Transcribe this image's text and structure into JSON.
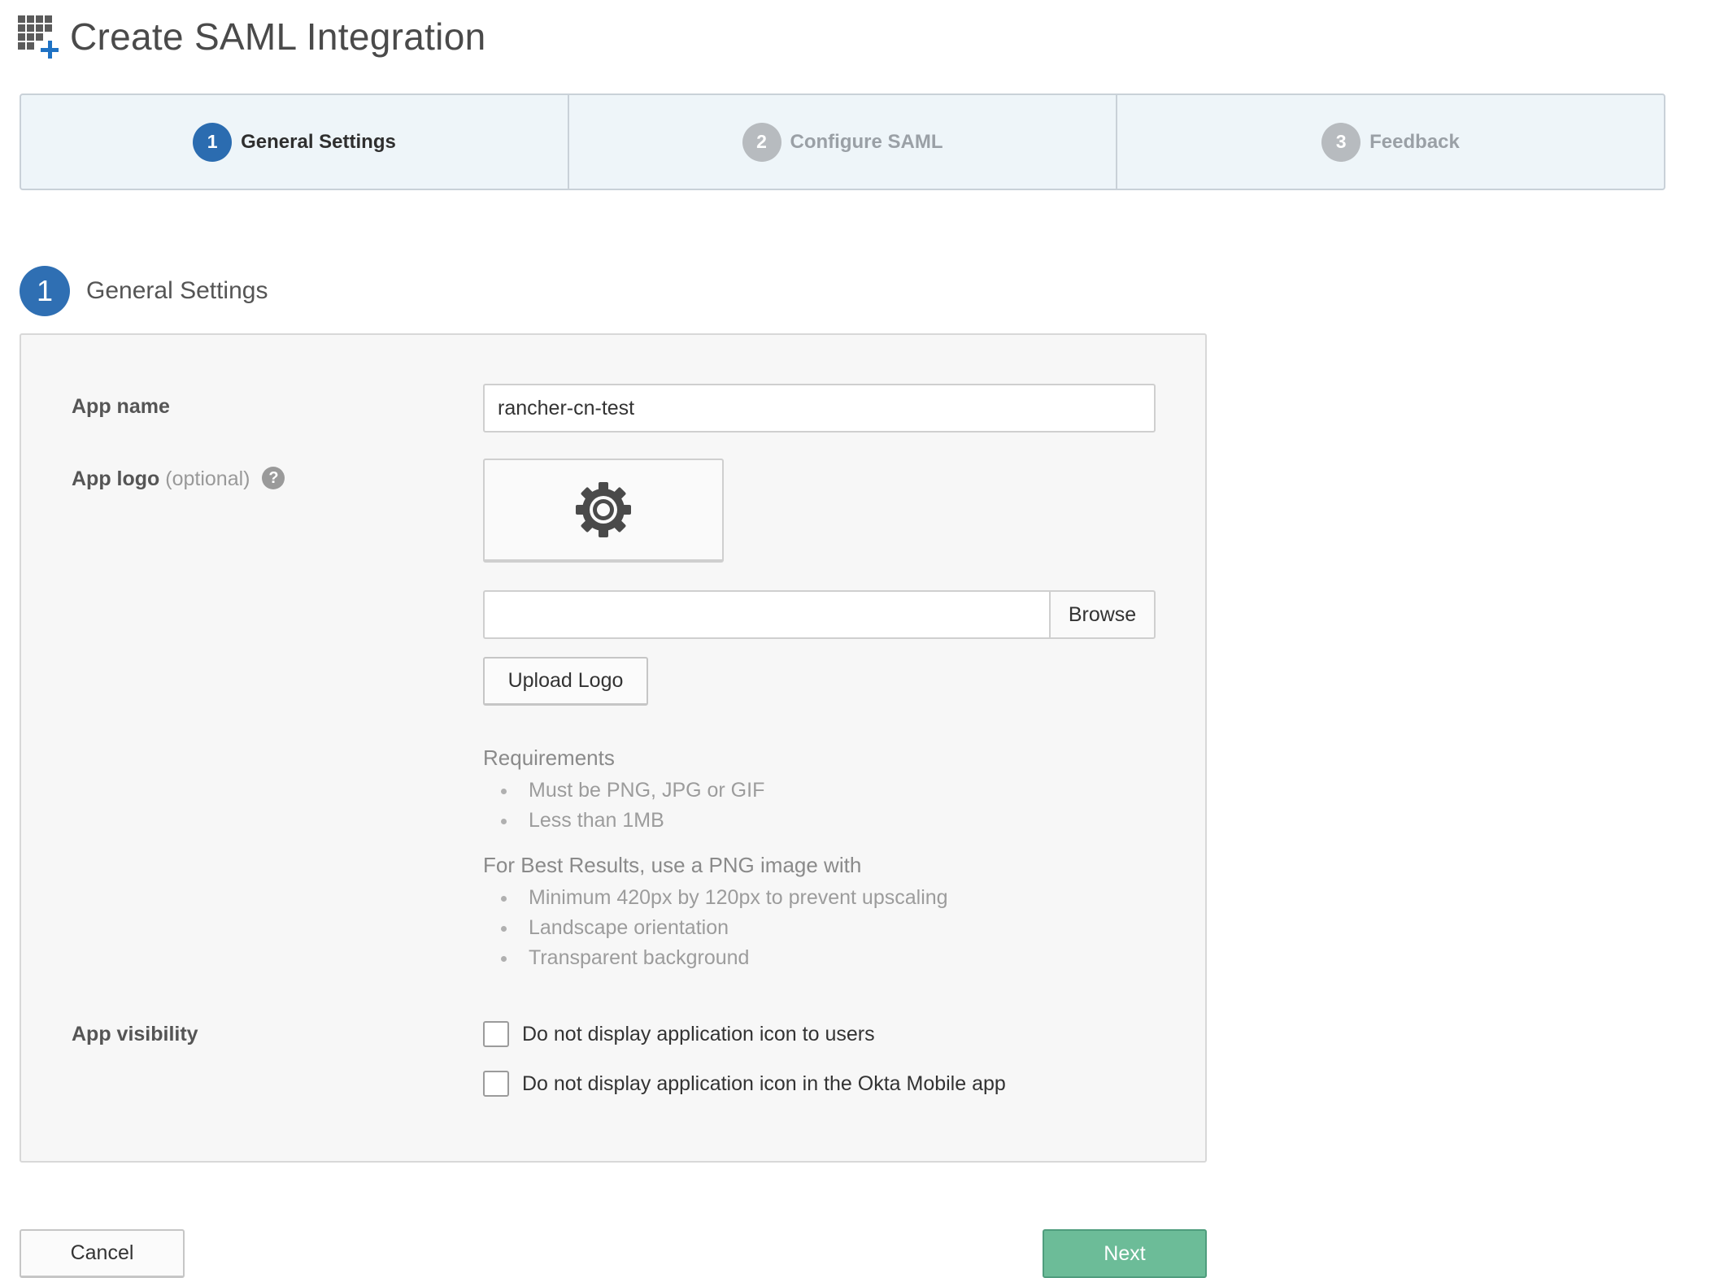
{
  "header": {
    "icon": "app-grid-add-icon",
    "title": "Create SAML Integration"
  },
  "wizard": {
    "steps": [
      {
        "number": "1",
        "label": "General Settings",
        "active": true
      },
      {
        "number": "2",
        "label": "Configure SAML",
        "active": false
      },
      {
        "number": "3",
        "label": "Feedback",
        "active": false
      }
    ]
  },
  "section": {
    "number": "1",
    "title": "General Settings"
  },
  "form": {
    "app_name": {
      "label": "App name",
      "value": "rancher-cn-test"
    },
    "app_logo": {
      "label": "App logo",
      "optional": "(optional)",
      "help": "?",
      "placeholder_icon": "gear-icon",
      "file_value": "",
      "browse_label": "Browse",
      "upload_label": "Upload Logo",
      "requirements_title": "Requirements",
      "requirements": [
        "Must be PNG, JPG or GIF",
        "Less than 1MB"
      ],
      "best_results_title": "For Best Results, use a PNG image with",
      "best_results": [
        "Minimum 420px by 120px to prevent upscaling",
        "Landscape orientation",
        "Transparent background"
      ]
    },
    "app_visibility": {
      "label": "App visibility",
      "options": [
        {
          "label": "Do not display application icon to users",
          "checked": false
        },
        {
          "label": "Do not display application icon in the Okta Mobile app",
          "checked": false
        }
      ]
    }
  },
  "footer": {
    "cancel_label": "Cancel",
    "next_label": "Next"
  },
  "colors": {
    "accent": "#2b6cb0",
    "next_button": "#6cbc98",
    "step_inactive": "#b7bbbf"
  }
}
